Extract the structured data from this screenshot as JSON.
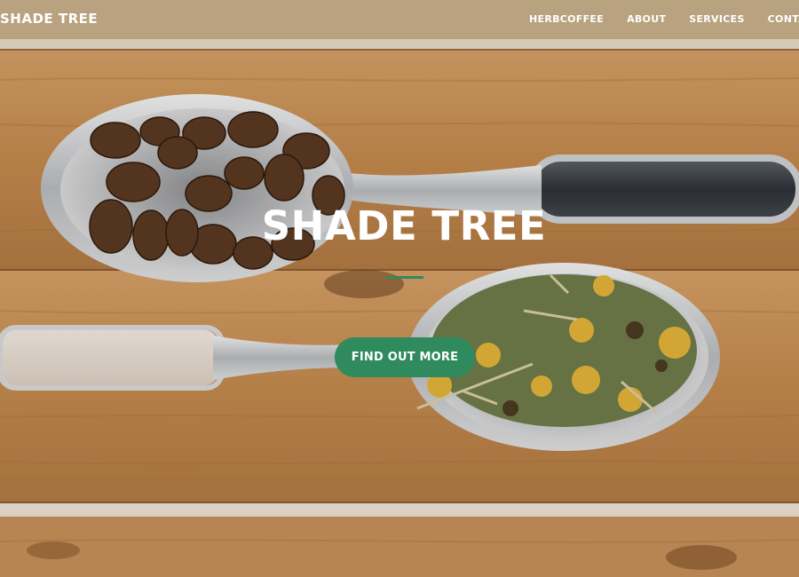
{
  "navbar": {
    "brand": "SHADE TREE",
    "links": [
      {
        "label": "HERBCOFFEE"
      },
      {
        "label": "ABOUT"
      },
      {
        "label": "SERVICES"
      },
      {
        "label": "CONTACT"
      }
    ]
  },
  "hero": {
    "title": "SHADE TREE",
    "cta_label": "FIND OUT MORE",
    "background_image": "wooden-table-with-coffee-bean-spoon-and-herbal-tea-spoon"
  },
  "colors": {
    "accent": "#2f8a5e",
    "text": "#ffffff",
    "wood": "#c48b4f"
  }
}
